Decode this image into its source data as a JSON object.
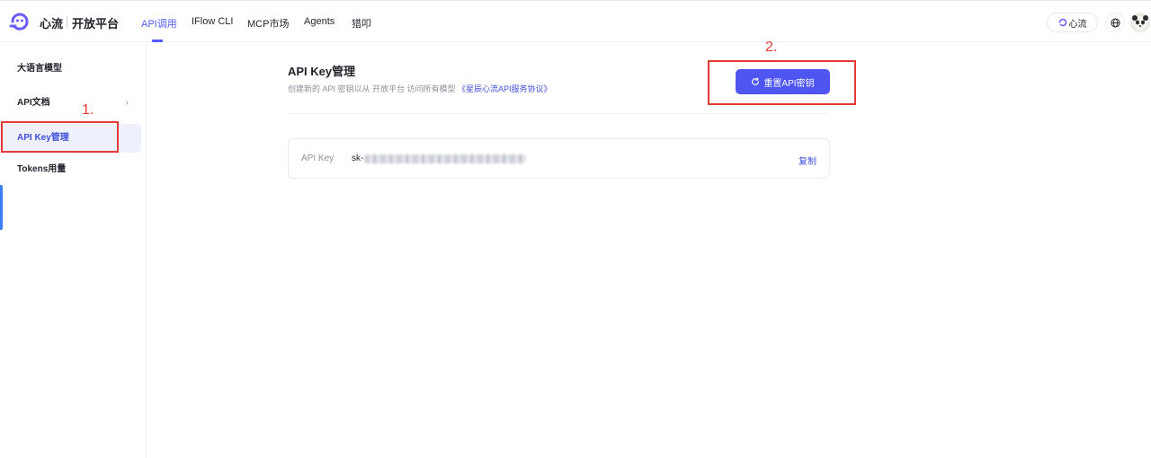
{
  "header": {
    "brand": "心流",
    "brand_sub": "开放平台",
    "nav": [
      {
        "label": "API调用",
        "active": true
      },
      {
        "label": "IFlow CLI",
        "active": false
      },
      {
        "label": "MCP市场",
        "active": false
      },
      {
        "label": "Agents",
        "active": false
      },
      {
        "label": "猎叩",
        "active": false
      }
    ],
    "xl_pill_label": "心流",
    "globe_icon": "globe-icon",
    "accent_color": "#4f5bff"
  },
  "sidebar": {
    "items": [
      {
        "label": "大语言模型",
        "active": false
      },
      {
        "label": "API文档",
        "active": false,
        "has_chevron": true
      },
      {
        "label": "API Key管理",
        "active": true
      },
      {
        "label": "Tokens用量",
        "active": false
      }
    ],
    "chevron": "›"
  },
  "main": {
    "title": "API Key管理",
    "description_prefix": "创建新的 API 密钥以从 开放平台 访问所有模型",
    "description_link": "《星辰心流API服务协议》",
    "reset_button": {
      "label": "重置API密钥",
      "icon": "refresh-icon",
      "color": "#4f55f0"
    },
    "key_card": {
      "label": "API Key",
      "prefix": "sk-",
      "masked": true,
      "copy_label": "复制"
    }
  },
  "annotations": {
    "step1": "1.",
    "step2": "2.",
    "color": "#e53935"
  }
}
